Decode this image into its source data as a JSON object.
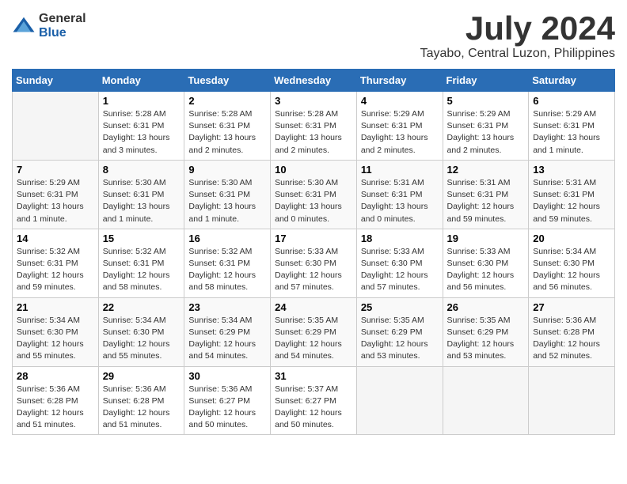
{
  "logo": {
    "general": "General",
    "blue": "Blue"
  },
  "title": "July 2024",
  "location": "Tayabo, Central Luzon, Philippines",
  "headers": [
    "Sunday",
    "Monday",
    "Tuesday",
    "Wednesday",
    "Thursday",
    "Friday",
    "Saturday"
  ],
  "weeks": [
    [
      {
        "day": "",
        "info": ""
      },
      {
        "day": "1",
        "info": "Sunrise: 5:28 AM\nSunset: 6:31 PM\nDaylight: 13 hours\nand 3 minutes."
      },
      {
        "day": "2",
        "info": "Sunrise: 5:28 AM\nSunset: 6:31 PM\nDaylight: 13 hours\nand 2 minutes."
      },
      {
        "day": "3",
        "info": "Sunrise: 5:28 AM\nSunset: 6:31 PM\nDaylight: 13 hours\nand 2 minutes."
      },
      {
        "day": "4",
        "info": "Sunrise: 5:29 AM\nSunset: 6:31 PM\nDaylight: 13 hours\nand 2 minutes."
      },
      {
        "day": "5",
        "info": "Sunrise: 5:29 AM\nSunset: 6:31 PM\nDaylight: 13 hours\nand 2 minutes."
      },
      {
        "day": "6",
        "info": "Sunrise: 5:29 AM\nSunset: 6:31 PM\nDaylight: 13 hours\nand 1 minute."
      }
    ],
    [
      {
        "day": "7",
        "info": "Sunrise: 5:29 AM\nSunset: 6:31 PM\nDaylight: 13 hours\nand 1 minute."
      },
      {
        "day": "8",
        "info": "Sunrise: 5:30 AM\nSunset: 6:31 PM\nDaylight: 13 hours\nand 1 minute."
      },
      {
        "day": "9",
        "info": "Sunrise: 5:30 AM\nSunset: 6:31 PM\nDaylight: 13 hours\nand 1 minute."
      },
      {
        "day": "10",
        "info": "Sunrise: 5:30 AM\nSunset: 6:31 PM\nDaylight: 13 hours\nand 0 minutes."
      },
      {
        "day": "11",
        "info": "Sunrise: 5:31 AM\nSunset: 6:31 PM\nDaylight: 13 hours\nand 0 minutes."
      },
      {
        "day": "12",
        "info": "Sunrise: 5:31 AM\nSunset: 6:31 PM\nDaylight: 12 hours\nand 59 minutes."
      },
      {
        "day": "13",
        "info": "Sunrise: 5:31 AM\nSunset: 6:31 PM\nDaylight: 12 hours\nand 59 minutes."
      }
    ],
    [
      {
        "day": "14",
        "info": "Sunrise: 5:32 AM\nSunset: 6:31 PM\nDaylight: 12 hours\nand 59 minutes."
      },
      {
        "day": "15",
        "info": "Sunrise: 5:32 AM\nSunset: 6:31 PM\nDaylight: 12 hours\nand 58 minutes."
      },
      {
        "day": "16",
        "info": "Sunrise: 5:32 AM\nSunset: 6:31 PM\nDaylight: 12 hours\nand 58 minutes."
      },
      {
        "day": "17",
        "info": "Sunrise: 5:33 AM\nSunset: 6:30 PM\nDaylight: 12 hours\nand 57 minutes."
      },
      {
        "day": "18",
        "info": "Sunrise: 5:33 AM\nSunset: 6:30 PM\nDaylight: 12 hours\nand 57 minutes."
      },
      {
        "day": "19",
        "info": "Sunrise: 5:33 AM\nSunset: 6:30 PM\nDaylight: 12 hours\nand 56 minutes."
      },
      {
        "day": "20",
        "info": "Sunrise: 5:34 AM\nSunset: 6:30 PM\nDaylight: 12 hours\nand 56 minutes."
      }
    ],
    [
      {
        "day": "21",
        "info": "Sunrise: 5:34 AM\nSunset: 6:30 PM\nDaylight: 12 hours\nand 55 minutes."
      },
      {
        "day": "22",
        "info": "Sunrise: 5:34 AM\nSunset: 6:30 PM\nDaylight: 12 hours\nand 55 minutes."
      },
      {
        "day": "23",
        "info": "Sunrise: 5:34 AM\nSunset: 6:29 PM\nDaylight: 12 hours\nand 54 minutes."
      },
      {
        "day": "24",
        "info": "Sunrise: 5:35 AM\nSunset: 6:29 PM\nDaylight: 12 hours\nand 54 minutes."
      },
      {
        "day": "25",
        "info": "Sunrise: 5:35 AM\nSunset: 6:29 PM\nDaylight: 12 hours\nand 53 minutes."
      },
      {
        "day": "26",
        "info": "Sunrise: 5:35 AM\nSunset: 6:29 PM\nDaylight: 12 hours\nand 53 minutes."
      },
      {
        "day": "27",
        "info": "Sunrise: 5:36 AM\nSunset: 6:28 PM\nDaylight: 12 hours\nand 52 minutes."
      }
    ],
    [
      {
        "day": "28",
        "info": "Sunrise: 5:36 AM\nSunset: 6:28 PM\nDaylight: 12 hours\nand 51 minutes."
      },
      {
        "day": "29",
        "info": "Sunrise: 5:36 AM\nSunset: 6:28 PM\nDaylight: 12 hours\nand 51 minutes."
      },
      {
        "day": "30",
        "info": "Sunrise: 5:36 AM\nSunset: 6:27 PM\nDaylight: 12 hours\nand 50 minutes."
      },
      {
        "day": "31",
        "info": "Sunrise: 5:37 AM\nSunset: 6:27 PM\nDaylight: 12 hours\nand 50 minutes."
      },
      {
        "day": "",
        "info": ""
      },
      {
        "day": "",
        "info": ""
      },
      {
        "day": "",
        "info": ""
      }
    ]
  ]
}
